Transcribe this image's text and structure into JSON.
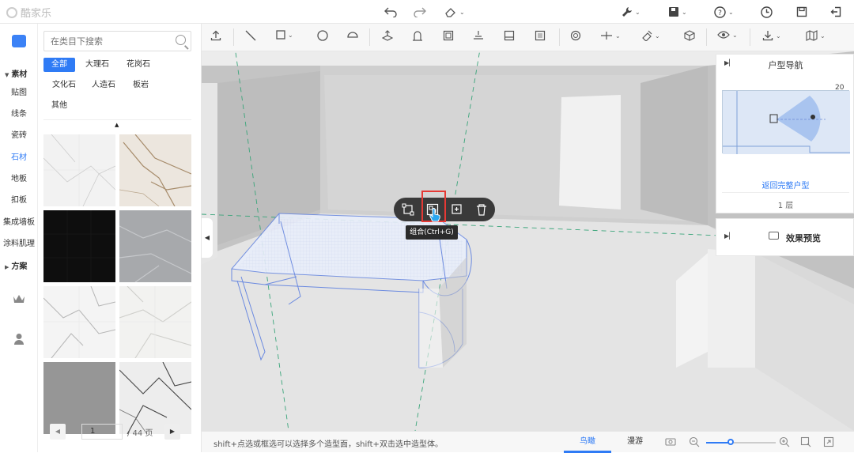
{
  "app": {
    "name": "酷家乐"
  },
  "topbar": {
    "undo": "undo-icon",
    "redo": "redo-icon",
    "eraser": "eraser-icon",
    "tools": "wrench-icon",
    "save": "save-icon",
    "help": "help-icon",
    "history": "clock-icon",
    "file": "file-icon",
    "exit": "exit-icon"
  },
  "leftnav": {
    "materials_label": "素材",
    "items": [
      "贴图",
      "线条",
      "瓷砖",
      "石材",
      "地板",
      "扣板",
      "集成墙板",
      "涂料肌理"
    ],
    "active": "石材",
    "plans_label": "方案"
  },
  "panel": {
    "search_placeholder": "在类目下搜索",
    "categories": [
      "全部",
      "大理石",
      "花岗石",
      "文化石",
      "人造石",
      "板岩",
      "其他"
    ],
    "active_category": "全部",
    "pager": {
      "current": "1",
      "total": "/ 44 页"
    }
  },
  "toolbar": {
    "icons": [
      "upload-icon",
      "line-icon",
      "rectangle-icon",
      "circle-icon",
      "arc-icon",
      "push-pull-icon",
      "rotate-icon",
      "select-frame-icon",
      "align-icon",
      "panel-icon",
      "grid-icon",
      "spiral-icon",
      "distribute-icon",
      "paint-icon",
      "cube-icon",
      "eye-icon",
      "download-icon",
      "map-icon"
    ]
  },
  "context_menu": {
    "items": [
      "transform-icon",
      "group-icon",
      "add-icon",
      "delete-icon"
    ],
    "tooltip": "组合(Ctrl+G)"
  },
  "nav_card": {
    "title": "户型导航",
    "zoom": "20",
    "back_link": "返回完整户型",
    "floor": "1 层"
  },
  "preview_card": {
    "title": "效果预览"
  },
  "statusbar": {
    "hint": "shift+点选或框选可以选择多个造型面，shift+双击选中造型体。",
    "views": [
      "鸟瞰",
      "漫游"
    ],
    "active_view": "鸟瞰",
    "zoom_fraction": 0.36
  }
}
